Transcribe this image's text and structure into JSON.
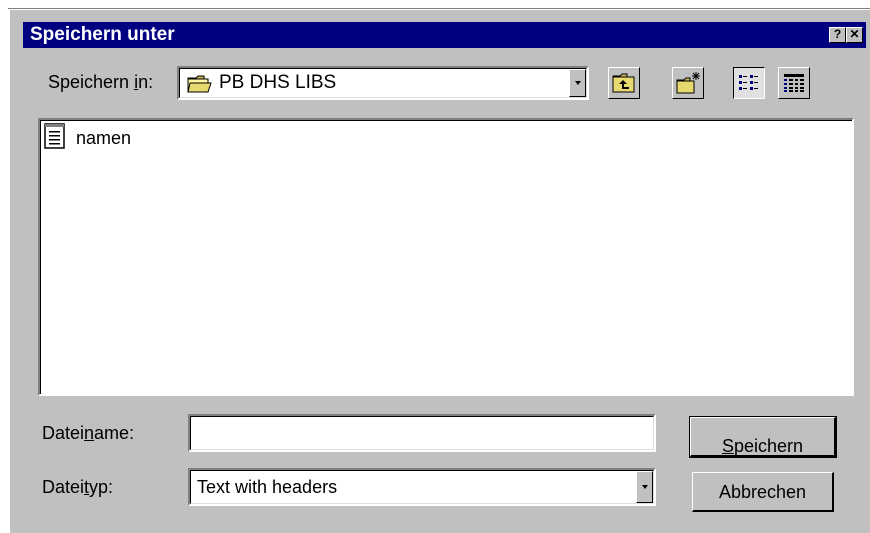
{
  "dialog": {
    "title": "Speichern unter",
    "help_label": "?",
    "close_label": "✕"
  },
  "save_in": {
    "label_pre": "Speichern ",
    "label_accel": "i",
    "label_post": "n:",
    "value": "PB DHS LIBS",
    "icon": "folder-icon"
  },
  "toolbar": {
    "up_icon": "up-folder-icon",
    "new_folder_icon": "new-folder-icon",
    "list_view_icon": "list-view-icon",
    "details_view_icon": "details-view-icon"
  },
  "files": [
    {
      "name": "namen",
      "icon": "text-document-icon"
    }
  ],
  "filename": {
    "label_pre": "Datei",
    "label_accel": "n",
    "label_post": "ame:",
    "value": "",
    "placeholder": ""
  },
  "filetype": {
    "label_pre": "Datei",
    "label_accel": "t",
    "label_post": "yp:",
    "value": "Text with headers"
  },
  "buttons": {
    "save_accel": "S",
    "save_rest": "peichern",
    "cancel": "Abbrechen"
  },
  "colors": {
    "titlebar": "#000080",
    "face": "#c0c0c0"
  }
}
